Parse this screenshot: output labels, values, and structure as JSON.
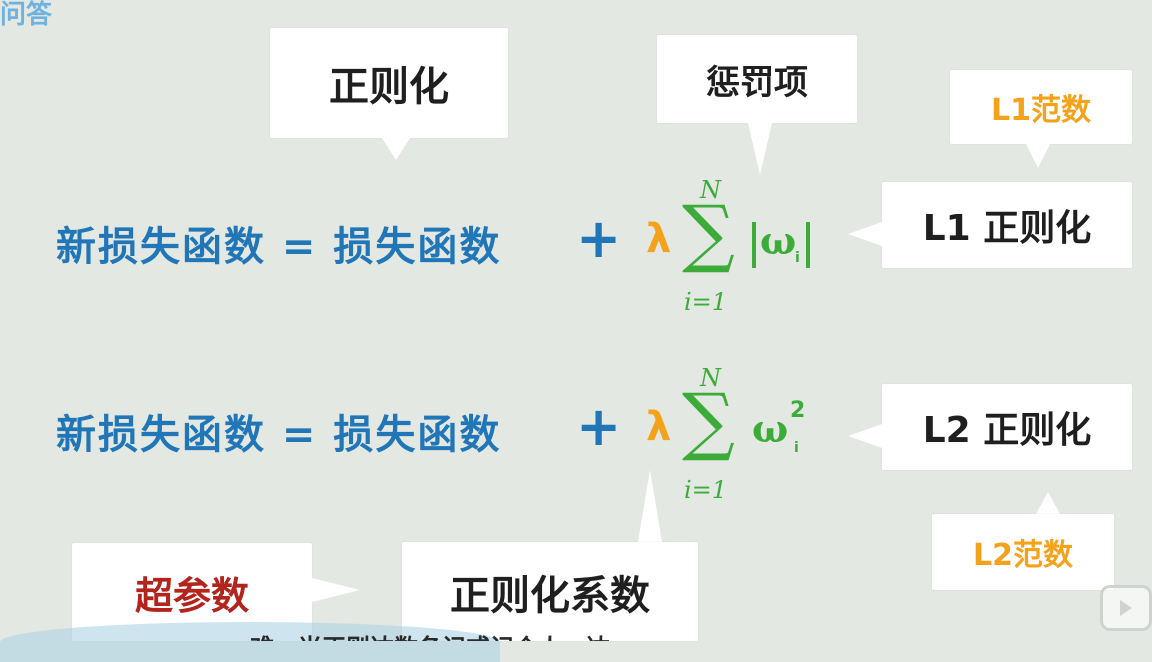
{
  "corner_label": "问答",
  "callouts": {
    "regularization": "正则化",
    "penalty_term": "惩罚项",
    "l1_norm": "L1范数",
    "l1_regularization": "L1 正则化",
    "l2_regularization": "L2 正则化",
    "l2_norm": "L2范数",
    "hyperparameter": "超参数",
    "regularization_coefficient": "正则化系数"
  },
  "formula_1": {
    "lhs": "新损失函数 = 损失函数",
    "plus": "+",
    "lambda": "λ",
    "sum": "∑",
    "upper": "N",
    "lower": "i=1",
    "term": "ω",
    "subscript": "i"
  },
  "formula_2": {
    "lhs": "新损失函数 = 损失函数",
    "plus": "+",
    "lambda": "λ",
    "sum": "∑",
    "upper": "N",
    "lower": "i=1",
    "term": "ω",
    "subscript": "i",
    "superscript": "2"
  },
  "bottom_subtitle": "难，当正则达数各记或记个人一达",
  "colors": {
    "formula_text": "#2176b8",
    "lambda": "#f4a21b",
    "sum_and_weights": "#3dab3a",
    "norm_labels": "#f4a21b",
    "hyperparameter": "#b2241c",
    "background": "#e3e8e2"
  }
}
